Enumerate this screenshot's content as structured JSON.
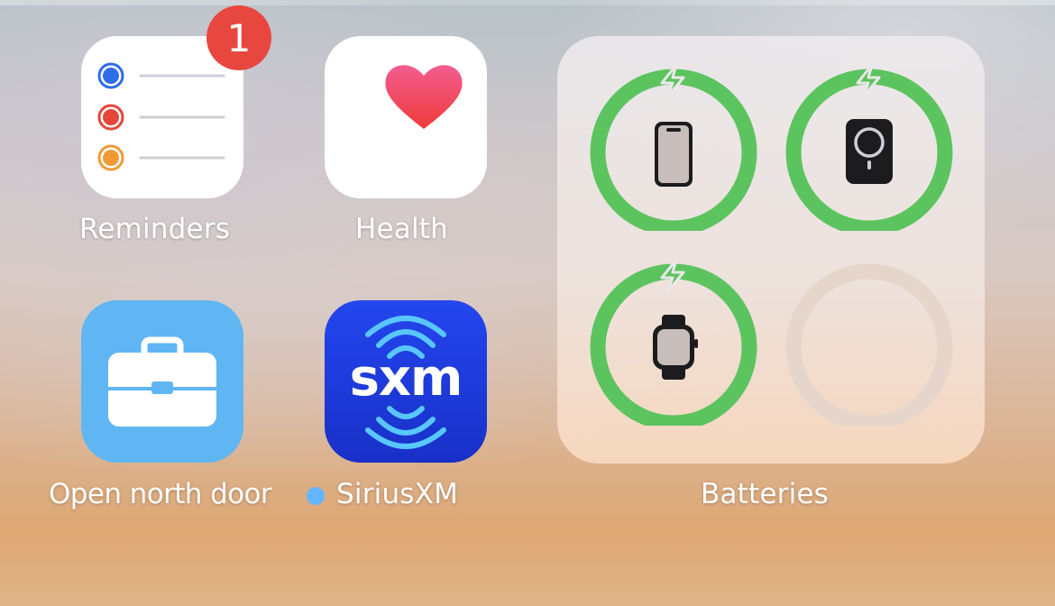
{
  "apps": {
    "reminders": {
      "label": "Reminders",
      "badge": "1",
      "icon": "reminders-icon"
    },
    "health": {
      "label": "Health",
      "icon": "heart-icon"
    },
    "shortcut": {
      "label": "Open north door",
      "icon": "briefcase-icon"
    },
    "siriusxm": {
      "label": "SiriusXM",
      "icon_text": "sxm",
      "new_indicator": "blue-dot",
      "icon": "siriusxm-icon"
    }
  },
  "widget": {
    "label": "Batteries",
    "devices": [
      {
        "name": "iPhone",
        "icon": "iphone-icon",
        "charging": true,
        "level": 1.0
      },
      {
        "name": "MagSafe Battery",
        "icon": "magsafe-battery-icon",
        "charging": true,
        "level": 1.0
      },
      {
        "name": "Apple Watch",
        "icon": "apple-watch-icon",
        "charging": true,
        "level": 1.0
      },
      {
        "name": "empty",
        "icon": "empty-slot",
        "charging": false,
        "level": 0
      }
    ]
  },
  "colors": {
    "badge": "#e8473f",
    "battery_green": "#5cc45f",
    "sxm_blue": "#1e3be0",
    "shortcut_blue": "#5fb6f2"
  }
}
